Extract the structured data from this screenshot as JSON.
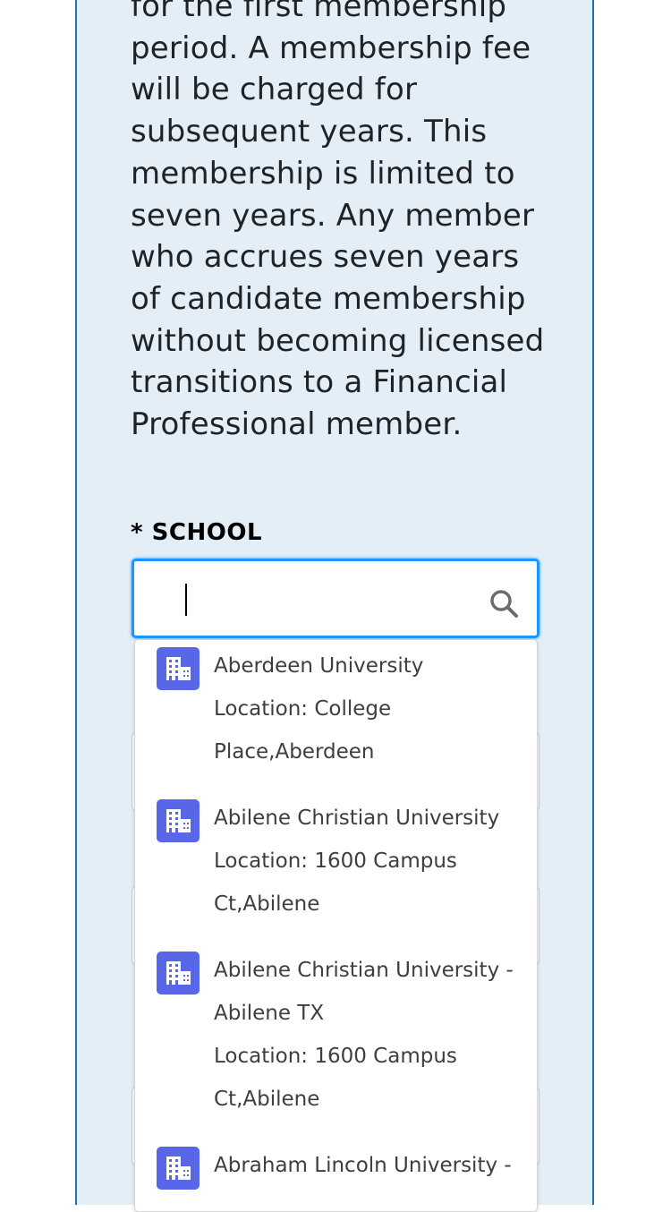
{
  "description": "for the first membership period. A membership fee will be charged for subsequent years. This membership is limited to seven years. Any member who accrues seven years of candidate membership without becoming licensed transitions to a Financial Professional member.",
  "school_field": {
    "required_marker": "*",
    "label": "SCHOOL",
    "value": "",
    "search_icon": "search-icon"
  },
  "dropdown": {
    "options": [
      {
        "icon": "building-icon",
        "name": "Aberdeen University",
        "location": "Location: College Place,Aberdeen"
      },
      {
        "icon": "building-icon",
        "name": "Abilene Christian University",
        "location": "Location: 1600 Campus Ct,Abilene"
      },
      {
        "icon": "building-icon",
        "name": "Abilene Christian University - Abilene TX",
        "location": "Location: 1600 Campus Ct,Abilene"
      },
      {
        "icon": "building-icon",
        "name": "Abraham Lincoln University -",
        "location": ""
      }
    ]
  },
  "colors": {
    "panel_bg": "#e3eef7",
    "panel_border": "#1f6fb2",
    "focus_border": "#1b96ff",
    "icon_bg": "#5867e8"
  }
}
